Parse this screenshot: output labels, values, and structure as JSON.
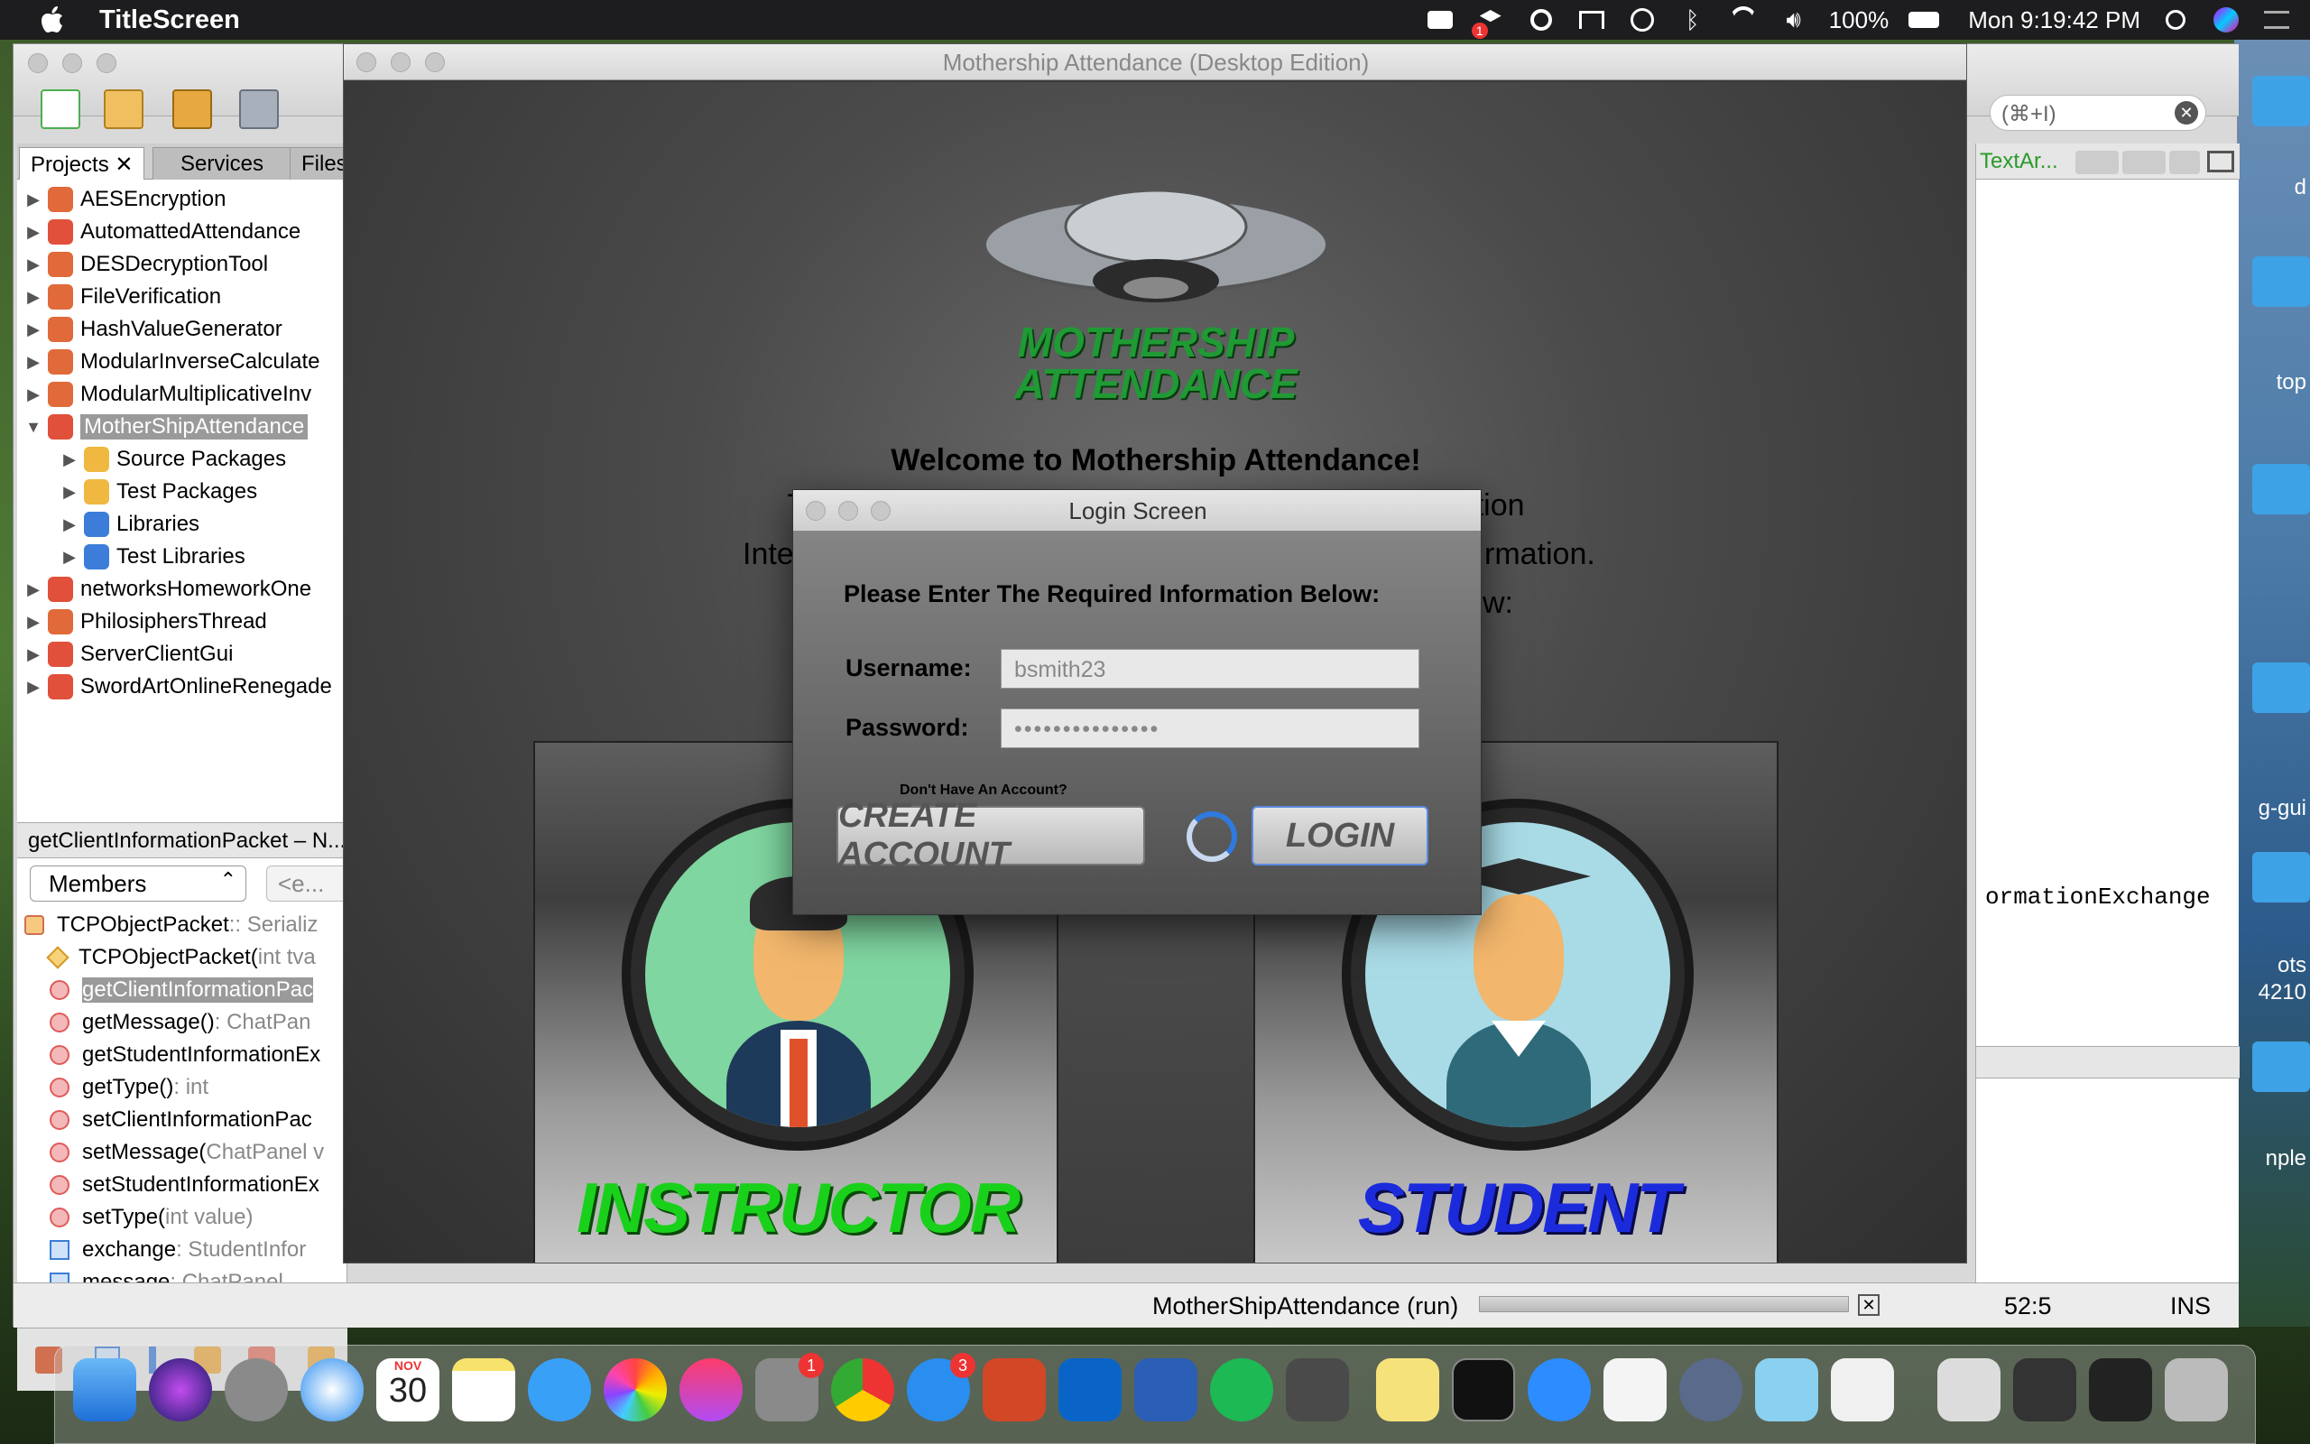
{
  "menubar": {
    "app_name": "TitleScreen",
    "battery": "100%",
    "clock": "Mon 9:19:42 PM",
    "notification_badge": "1"
  },
  "ide": {
    "search_placeholder": "(⌘+I)",
    "tabs": [
      "Projects",
      "Services",
      "Files"
    ],
    "projects": [
      {
        "label": "AESEncryption",
        "expanded": false,
        "indent": 0
      },
      {
        "label": "AutomattedAttendance",
        "expanded": false,
        "indent": 0
      },
      {
        "label": "DESDecryptionTool",
        "expanded": false,
        "indent": 0
      },
      {
        "label": "FileVerification",
        "expanded": false,
        "indent": 0
      },
      {
        "label": "HashValueGenerator",
        "expanded": false,
        "indent": 0
      },
      {
        "label": "ModularInverseCalculate",
        "expanded": false,
        "indent": 0
      },
      {
        "label": "ModularMultiplicativeInv",
        "expanded": false,
        "indent": 0
      },
      {
        "label": "MotherShipAttendance",
        "expanded": true,
        "indent": 0,
        "selected": true
      },
      {
        "label": "Source Packages",
        "expanded": false,
        "indent": 1
      },
      {
        "label": "Test Packages",
        "expanded": false,
        "indent": 1
      },
      {
        "label": "Libraries",
        "expanded": false,
        "indent": 1
      },
      {
        "label": "Test Libraries",
        "expanded": false,
        "indent": 1
      },
      {
        "label": "networksHomeworkOne",
        "expanded": false,
        "indent": 0
      },
      {
        "label": "PhilosiphersThread",
        "expanded": false,
        "indent": 0
      },
      {
        "label": "ServerClientGui",
        "expanded": false,
        "indent": 0
      },
      {
        "label": "SwordArtOnlineRenegade",
        "expanded": false,
        "indent": 0
      }
    ],
    "navigator_title": "getClientInformationPacket – N...",
    "members_select": "Members",
    "members_filter": "<e...",
    "members": [
      {
        "name": "TCPObjectPacket",
        "type": " :: Serializ",
        "kind": "class"
      },
      {
        "name": "TCPObjectPacket(",
        "type": "int tva",
        "kind": "ctor"
      },
      {
        "name": "getClientInformationPac",
        "type": "",
        "kind": "method",
        "selected": true
      },
      {
        "name": "getMessage() ",
        "type": ": ChatPan",
        "kind": "method"
      },
      {
        "name": "getStudentInformationEx",
        "type": "",
        "kind": "method"
      },
      {
        "name": "getType() ",
        "type": ": int",
        "kind": "method"
      },
      {
        "name": "setClientInformationPac",
        "type": "",
        "kind": "method"
      },
      {
        "name": "setMessage(",
        "type": "ChatPanel v",
        "kind": "method"
      },
      {
        "name": "setStudentInformationEx",
        "type": "",
        "kind": "method"
      },
      {
        "name": "setType(",
        "type": "int value)",
        "kind": "method"
      },
      {
        "name": "exchange ",
        "type": ": StudentInfor",
        "kind": "field"
      },
      {
        "name": "message ",
        "type": ": ChatPanel",
        "kind": "field"
      }
    ],
    "right_tab": "TextAr...",
    "right_code": "ormationExchange",
    "status_run": "MotherShipAttendance (run)",
    "status_pos": "52:5",
    "status_mode": "INS"
  },
  "app": {
    "window_title": "Mothership Attendance (Desktop Edition)",
    "logo_line1": "MOTHERSHIP",
    "logo_line2": "ATTENDANCE",
    "welcome_title": "Welcome to Mothership Attendance!",
    "welcome_line2": "This Application Uses a TCP Server/Client Connection",
    "welcome_line3_left": "Inte",
    "welcome_line3_right": "rmation.",
    "welcome_line4_right": "w:",
    "instructor_label": "INSTRUCTOR",
    "student_label": "STUDENT"
  },
  "login": {
    "title": "Login Screen",
    "prompt": "Please Enter The Required Information Below:",
    "username_label": "Username:",
    "username_value": "bsmith23",
    "password_label": "Password:",
    "password_value": "•••••••••••••••",
    "account_hint": "Don't Have An Account?",
    "create_button": "CREATE ACCOUNT",
    "login_button": "LOGIN"
  },
  "desktop": {
    "labels": [
      "d",
      "top",
      "g-gui",
      "ots",
      "4210",
      "nple"
    ]
  },
  "dock": {
    "calendar_month": "NOV",
    "calendar_day": "30",
    "badges": [
      "1",
      "3"
    ]
  },
  "colors": {
    "instructor_green": "#19d11a",
    "student_blue": "#1b2bdc",
    "logo_green": "#1f9a34"
  }
}
